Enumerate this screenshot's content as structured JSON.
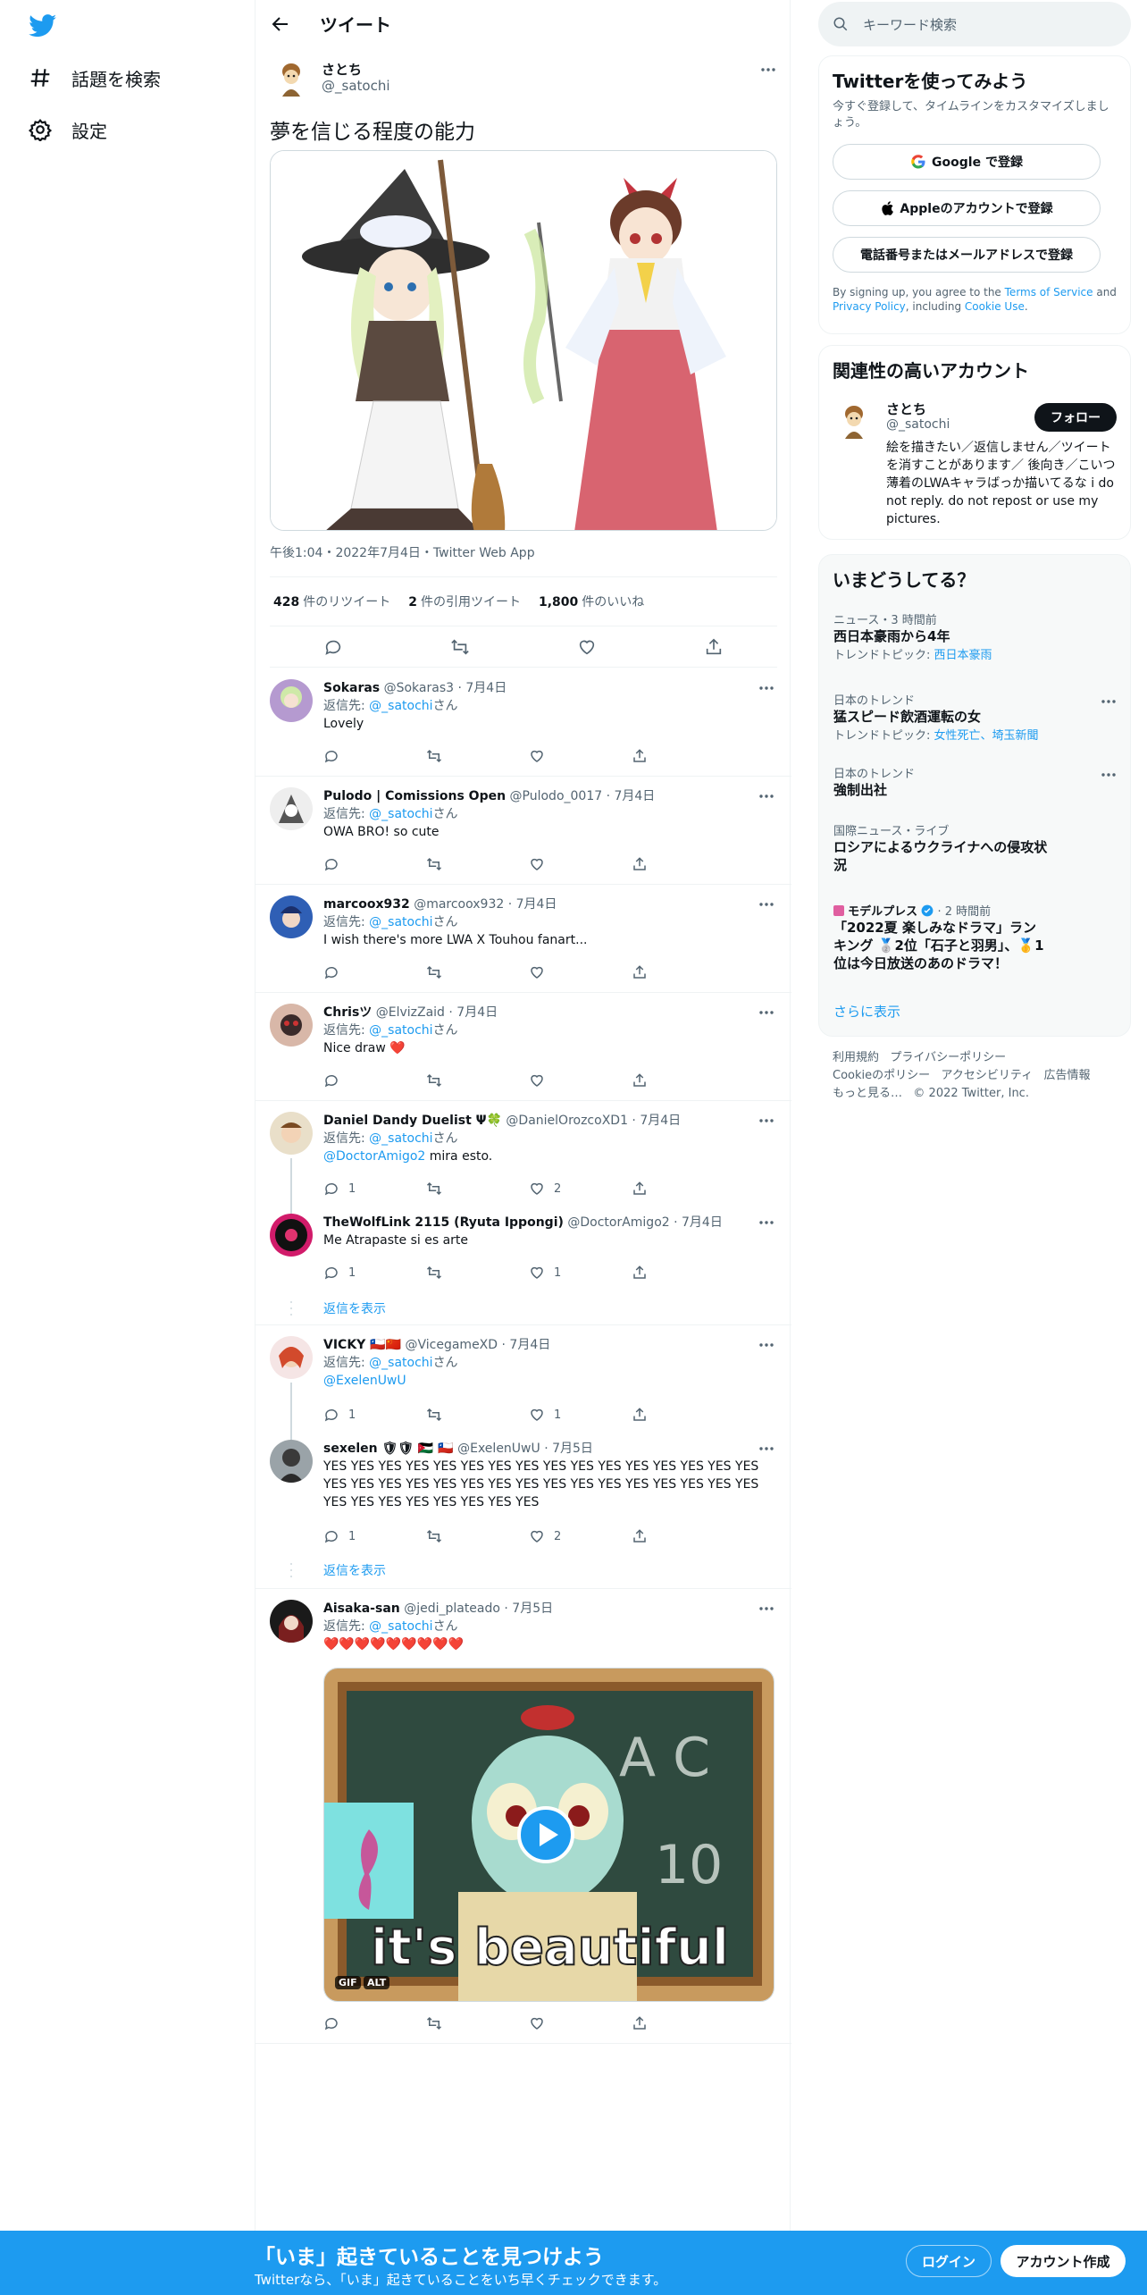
{
  "nav": {
    "explore": "話題を検索",
    "settings": "設定"
  },
  "header": {
    "title": "ツイート"
  },
  "tweet": {
    "name": "さとち",
    "handle": "@_satochi",
    "text": "夢を信じる程度の能力",
    "meta": "午後1:04・2022年7月4日・Twitter Web App",
    "retweets_count": "428",
    "retweets_label": "件のリツイート",
    "quotes_count": "2",
    "quotes_label": "件の引用ツイート",
    "likes_count": "1,800",
    "likes_label": "件のいいね"
  },
  "replies": [
    {
      "name": "Sokaras",
      "handle": "@Sokaras3 · 7月4日",
      "reply_to_prefix": "返信先: ",
      "reply_to": "@_satochi",
      "reply_to_suffix": "さん",
      "text": "Lovely",
      "replies": "",
      "retweets": "",
      "likes": ""
    },
    {
      "name": "Pulodo | Comissions Open",
      "handle": "@Pulodo_0017 · 7月4日",
      "reply_to_prefix": "返信先: ",
      "reply_to": "@_satochi",
      "reply_to_suffix": "さん",
      "text": "OWA BRO! so cute",
      "replies": "",
      "retweets": "",
      "likes": ""
    },
    {
      "name": "marcoox932",
      "handle": "@marcoox932 · 7月4日",
      "reply_to_prefix": "返信先: ",
      "reply_to": "@_satochi",
      "reply_to_suffix": "さん",
      "text": "I wish there's more LWA X Touhou fanart...",
      "replies": "",
      "retweets": "",
      "likes": ""
    },
    {
      "name": "Chrisツ",
      "handle": "@ElvizZaid · 7月4日",
      "reply_to_prefix": "返信先: ",
      "reply_to": "@_satochi",
      "reply_to_suffix": "さん",
      "text": "Nice draw ❤️",
      "replies": "",
      "retweets": "",
      "likes": ""
    },
    {
      "name": "Daniel Dandy Duelist Ψ🍀",
      "handle": "@DanielOrozcoXD1 · 7月4日",
      "reply_to_prefix": "返信先: ",
      "reply_to": "@_satochi",
      "reply_to_suffix": "さん",
      "mention": "@DoctorAmigo2",
      "text": " mira esto.",
      "replies": "1",
      "retweets": "",
      "likes": "2"
    },
    {
      "name": "TheWolfLink 2115 (Ryuta Ippongi)",
      "handle": "@DoctorAmigo2 · 7月4日",
      "text": "Me Atrapaste si es arte",
      "replies": "1",
      "retweets": "",
      "likes": "1"
    },
    {
      "name": "VICKY 🇨🇱🇨🇳",
      "handle": "@VicegameXD · 7月4日",
      "reply_to_prefix": "返信先: ",
      "reply_to": "@_satochi",
      "reply_to_suffix": "さん",
      "mention": "@ExelenUwU",
      "replies": "1",
      "retweets": "",
      "likes": "1"
    },
    {
      "name": "sexelen 🛡🛡 🇯🇴 🇨🇱",
      "handle": "@ExelenUwU · 7月5日",
      "text": "YES YES YES YES YES YES YES YES YES YES YES YES YES YES YES YES YES YES YES YES YES YES YES YES YES YES YES YES YES YES YES YES YES YES YES YES YES YES YES YES",
      "replies": "1",
      "retweets": "",
      "likes": "2"
    },
    {
      "name": "Aisaka-san",
      "handle": "@jedi_plateado · 7月5日",
      "reply_to_prefix": "返信先: ",
      "reply_to": "@_satochi",
      "reply_to_suffix": "さん",
      "text": "❤️❤️❤️❤️❤️❤️❤️❤️❤️",
      "media_caption": "it's beautiful",
      "gif_badge": "GIF",
      "alt_badge": "ALT",
      "replies": "",
      "retweets": "",
      "likes": ""
    }
  ],
  "show_replies": "返信を表示",
  "search": {
    "placeholder": "キーワード検索"
  },
  "signup_card": {
    "title": "Twitterを使ってみよう",
    "subtitle": "今すぐ登録して、タイムラインをカスタマイズしましょう。",
    "google": "Google で登録",
    "apple": "Appleのアカウントで登録",
    "phone": "電話番号またはメールアドレスで登録",
    "terms_1": "By signing up, you agree to the ",
    "terms_link": "Terms of Service",
    "terms_2": " and ",
    "privacy_link": "Privacy Policy",
    "terms_3": ", including ",
    "cookie_link": "Cookie Use",
    "terms_4": "."
  },
  "related": {
    "title": "関連性の高いアカウント",
    "name": "さとち",
    "handle": "@_satochi",
    "follow": "フォロー",
    "bio": "絵を描きたい／返信しません／ツイートを消すことがあります／ 後向き／こいつ薄着のLWAキャラばっか描いてるな i do not reply. do not repost or use my pictures."
  },
  "trends": {
    "title": "いまどうしてる？",
    "items": [
      {
        "category": "ニュース・3 時間前",
        "title": "西日本豪雨から4年",
        "sub_prefix": "トレンドトピック: ",
        "sub_link": "西日本豪雨"
      },
      {
        "category": "日本のトレンド",
        "title": "猛スピード飲酒運転の女",
        "sub_prefix": "トレンドトピック: ",
        "sub_link": "女性死亡、埼玉新聞"
      },
      {
        "category": "日本のトレンド",
        "title": "強制出社"
      },
      {
        "category": "国際ニュース・ライブ",
        "title": "ロシアによるウクライナへの侵攻状況"
      },
      {
        "category": "モデルプレス",
        "category_suffix": " · 2 時間前",
        "title": "「2022夏 楽しみなドラマ」ランキング 🥈2位「石子と羽男」、🥇1位は今日放送のあのドラマ！"
      }
    ],
    "more": "さらに表示"
  },
  "footer": {
    "links": [
      "利用規約",
      "プライバシーポリシー",
      "Cookieのポリシー",
      "アクセシビリティ",
      "広告情報",
      "もっと見る…"
    ],
    "copyright": "© 2022 Twitter, Inc."
  },
  "bottom_bar": {
    "title": "「いま」起きていることを見つけよう",
    "subtitle": "Twitterなら、「いま」起きていることをいち早くチェックできます。",
    "login": "ログイン",
    "signup": "アカウント作成"
  },
  "colors": {
    "accent": "#1d9bf0",
    "text": "#0f1419",
    "muted": "#536471"
  }
}
